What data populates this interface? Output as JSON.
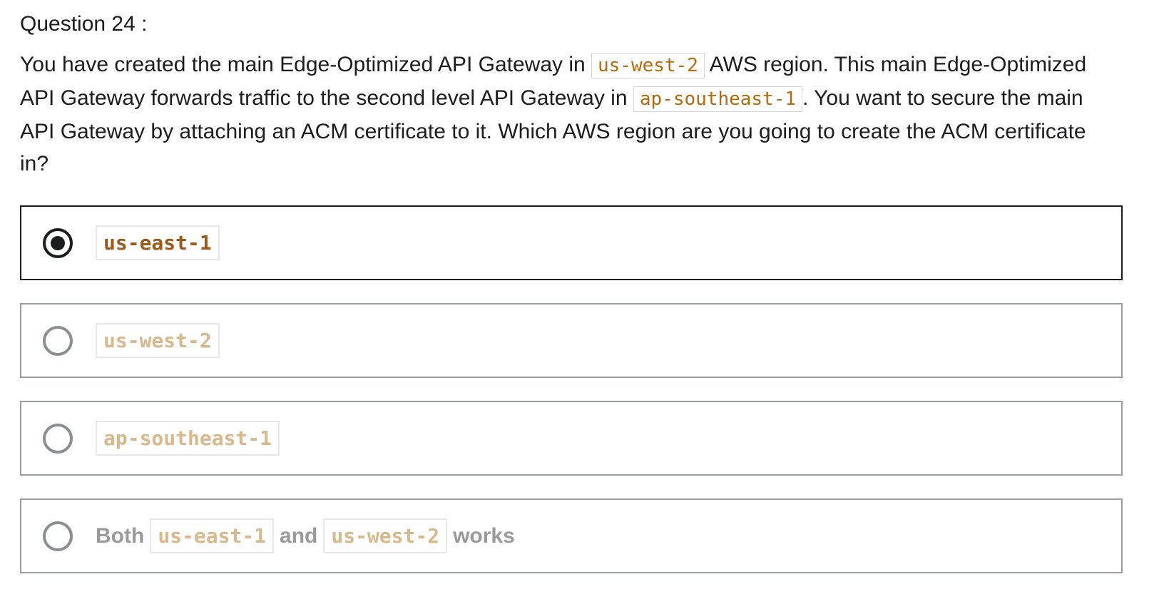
{
  "question": {
    "label": "Question 24 :",
    "text_parts": [
      "You have created the main Edge-Optimized API Gateway in ",
      "us-west-2",
      " AWS region. This main Edge-Optimized API Gateway forwards traffic to the second level API Gateway in ",
      "ap-southeast-1",
      ". You want to secure the main API Gateway by attaching an ACM certificate to it. Which AWS region are you going to create the ACM certificate in?"
    ]
  },
  "options": [
    {
      "code": "us-east-1",
      "selected": true
    },
    {
      "code": "us-west-2",
      "selected": false
    },
    {
      "code": "ap-southeast-1",
      "selected": false
    },
    {
      "parts": [
        "Both",
        "us-east-1",
        "and",
        "us-west-2",
        "works"
      ],
      "selected": false
    }
  ],
  "colors": {
    "text": "#1c1d1f",
    "code": "#b4690e",
    "code_faded": "#d9b88e",
    "border": "#999fa3"
  }
}
